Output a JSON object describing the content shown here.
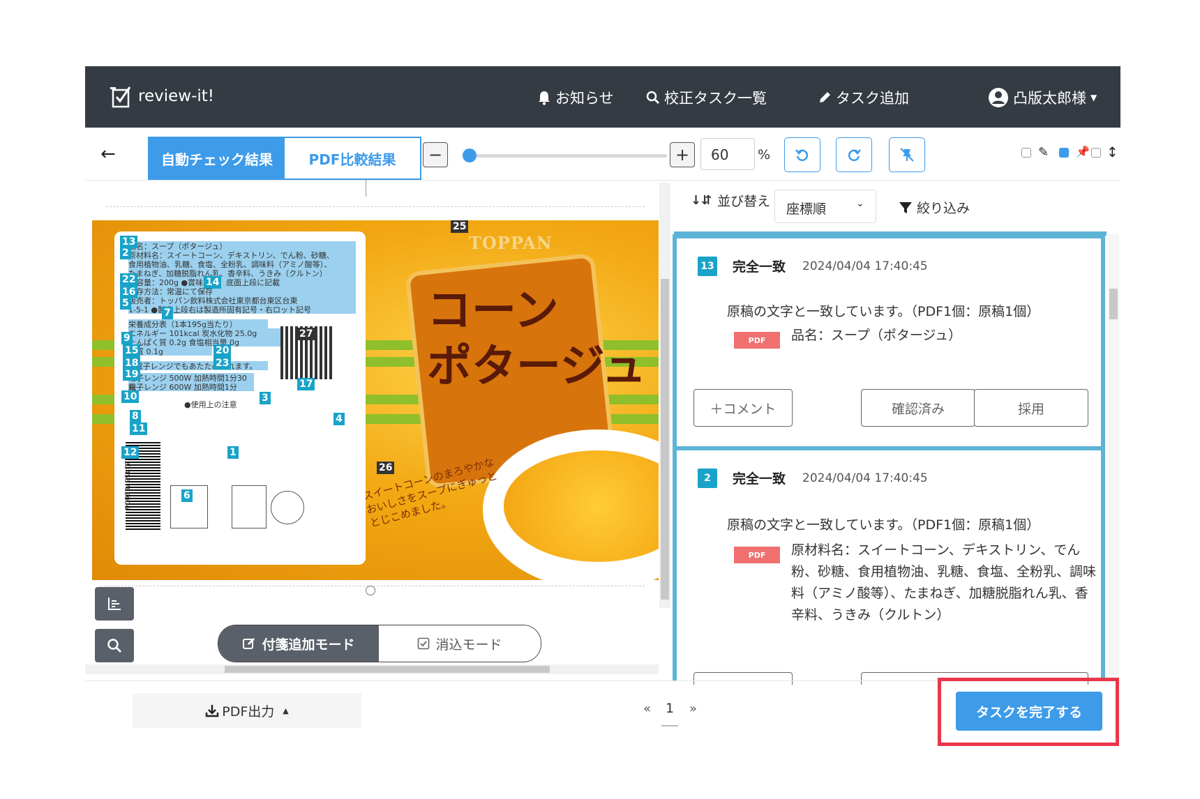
{
  "header": {
    "app_name": "review-it!",
    "nav": {
      "notifications": "お知らせ",
      "task_list": "校正タスク一覧",
      "add_task": "タスク追加",
      "user": "凸版太郎様"
    }
  },
  "toolbar": {
    "tabs": [
      "自動チェック結果",
      "PDF比較結果"
    ],
    "zoom_value": "60",
    "zoom_unit": "%",
    "zoom_level": 0.03
  },
  "viewer": {
    "brand": "TOPPAN",
    "product_title": [
      "コーン",
      "ポタージュ"
    ],
    "catchphrase": "スイートコーンのまろやかなおいしさをスープにぎゅっととじこめました。",
    "label_lines": [
      "品名：スープ（ポタージュ）",
      "原材料名：スイートコーン、デキストリン、でん粉、砂糖、",
      "食用植物油、乳糖、食塩、全粉乳、調味料（アミノ酸等）、",
      "たまねぎ、加糖脱脂れん乳、香辛料、うきみ（クルトン）",
      "内容量：200g ●賞味期限：底面上段に記載",
      "保存方法：常温にて保存",
      "販売者：トッパン飲料株式会社東京都台東区台東",
      "1-5-1 ●製造上段右は製造所固有記号・右ロット記号",
      "栄養成分表（1本195g当たり）",
      "エネルギー 101kcal 炭水化物 25.0g",
      "たんぱく質 0.2g 食塩相当量 0g",
      "脂質 0.1g",
      "●電子レンジでもあたためられます。",
      "電子レンジ 500W 加熱時間1分30秒",
      "電子レンジ 600W 加熱時間1分",
      "●使用上の注意"
    ],
    "barcode": "9123456789006",
    "markers": [
      "13",
      "2",
      "22",
      "16",
      "14",
      "5",
      "7",
      "9",
      "15",
      "18",
      "19",
      "20",
      "23",
      "27",
      "17",
      "10",
      "3",
      "8",
      "11",
      "4",
      "12",
      "1",
      "6",
      "25",
      "26"
    ],
    "mode_buttons": [
      "付箋追加モード",
      "消込モード"
    ]
  },
  "results": {
    "sort_label": "並び替え",
    "sort_value": "座標順",
    "filter_label": "絞り込み",
    "cards": [
      {
        "number": "13",
        "status": "完全一致",
        "timestamp": "2024/04/04 17:40:45",
        "message": "原稿の文字と一致しています。（PDF1個：原稿1個）",
        "badge": "PDF",
        "content": "品名：スープ（ポタージュ）",
        "comment_button": "＋コメント",
        "confirm_button": "確認済み",
        "adopt_button": "採用"
      },
      {
        "number": "2",
        "status": "完全一致",
        "timestamp": "2024/04/04 17:40:45",
        "message": "原稿の文字と一致しています。（PDF1個：原稿1個）",
        "badge": "PDF",
        "content": "原材料名：スイートコーン、デキストリン、でん粉、砂糖、食用植物油、乳糖、食塩、全粉乳、調味料（アミノ酸等）、たまねぎ、加糖脱脂れん乳、香辛料、うきみ（クルトン）"
      }
    ]
  },
  "footer": {
    "pdf_output": "PDF出力",
    "prev": "«",
    "page": "1",
    "next": "»",
    "complete_task": "タスクを完了する"
  },
  "colors": {
    "header_bg": "#353b42",
    "accent": "#3d9be9",
    "card_border": "#5cb4d6",
    "marker": "#1aa3c8",
    "pdf_badge": "#f07070",
    "highlight_frame": "#e8364a"
  }
}
